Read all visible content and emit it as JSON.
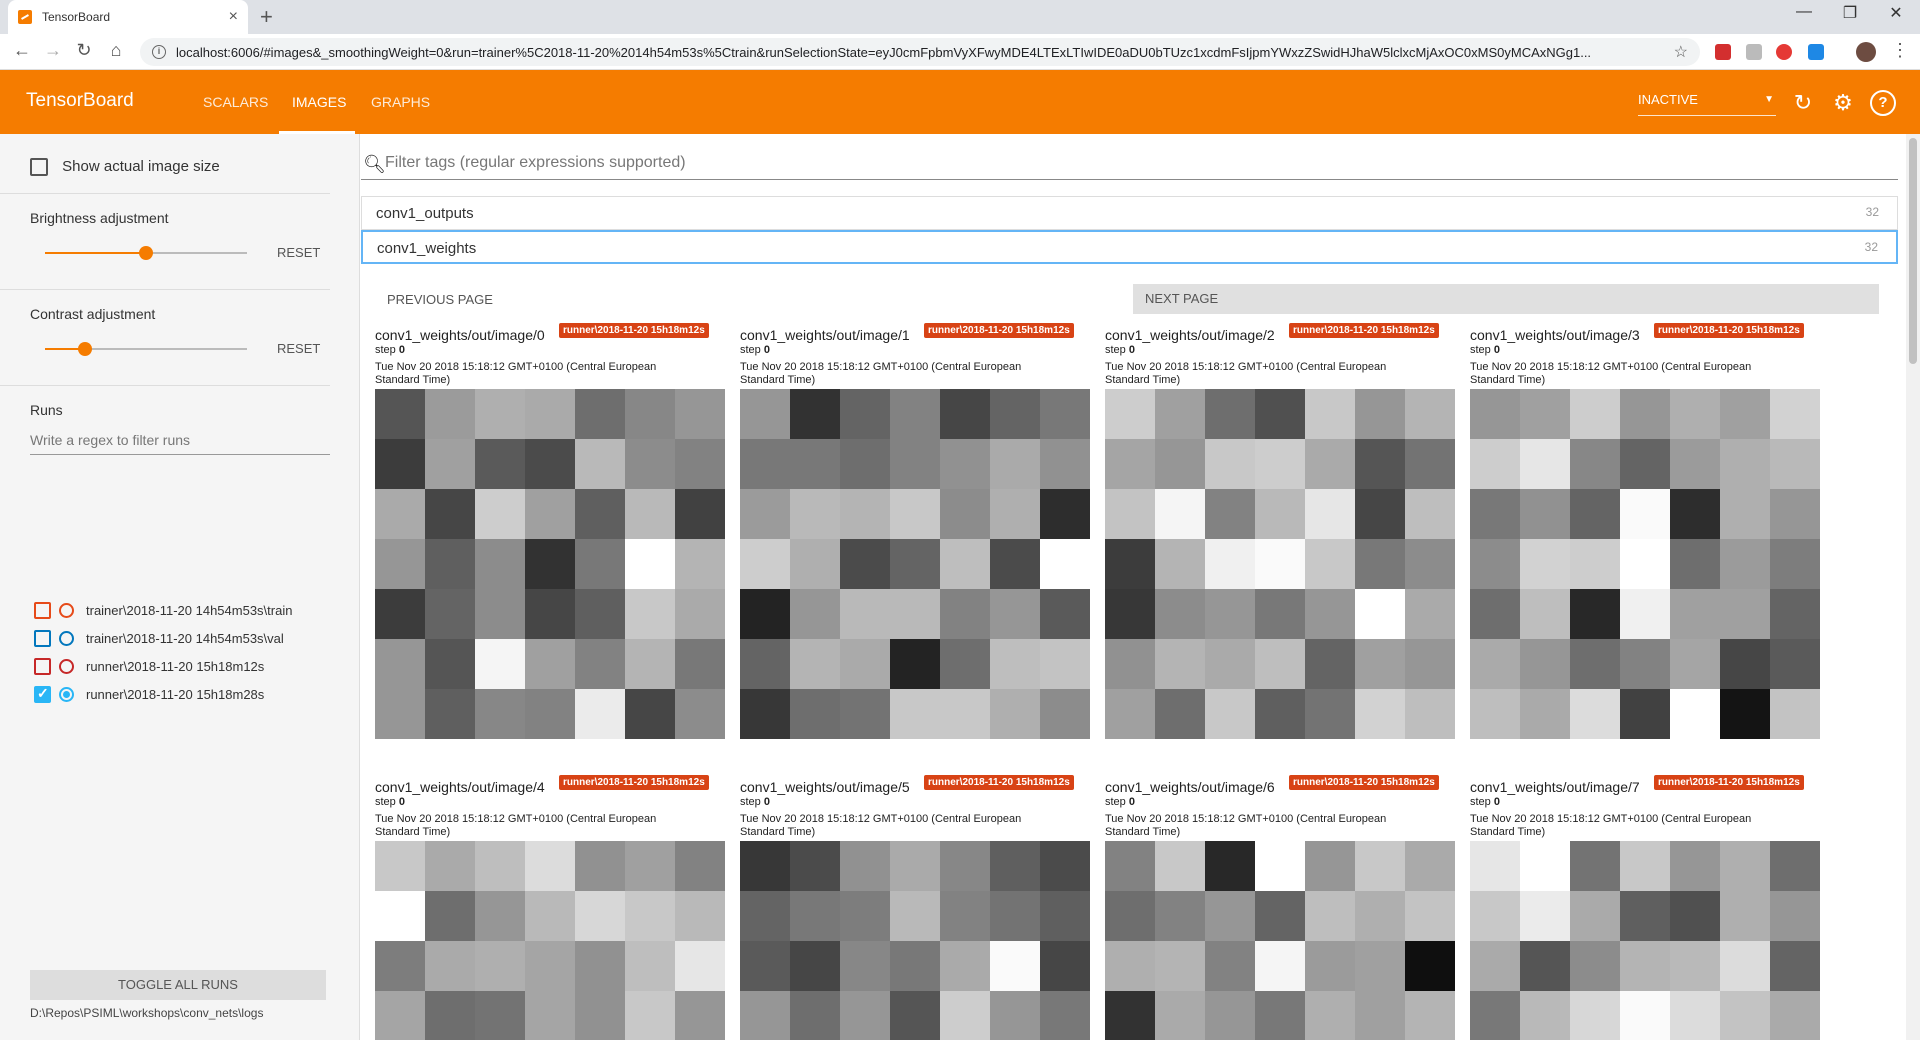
{
  "browser": {
    "tab_title": "TensorBoard",
    "url": "localhost:6006/#images&_smoothingWeight=0&run=trainer%5C2018-11-20%2014h54m53s%5Ctrain&runSelectionState=eyJ0cmFpbmVyXFwyMDE4LTExLTIwIDE0aDU0bTUzc1xcdmFsIjpmYWxzZSwidHJhaW5lclxcMjAxOC0xMS0yMCAxNGg1..."
  },
  "app": {
    "brand": "TensorBoard",
    "tabs": [
      "SCALARS",
      "IMAGES",
      "GRAPHS"
    ],
    "active_tab": "IMAGES",
    "status_select": "INACTIVE",
    "accent_color": "#f57c00"
  },
  "sidebar": {
    "show_actual_size": "Show actual image size",
    "brightness_title": "Brightness adjustment",
    "brightness_level": 0.5,
    "contrast_title": "Contrast adjustment",
    "contrast_level": 0.2,
    "reset_label": "RESET",
    "runs_title": "Runs",
    "runs_filter_placeholder": "Write a regex to filter runs",
    "runs": [
      {
        "name": "trainer\\2018-11-20 14h54m53s\\train",
        "color": "#e64a19",
        "checked": false,
        "selected": false
      },
      {
        "name": "trainer\\2018-11-20 14h54m53s\\val",
        "color": "#0277bd",
        "checked": false,
        "selected": false
      },
      {
        "name": "runner\\2018-11-20 15h18m12s",
        "color": "#c62828",
        "checked": false,
        "selected": false
      },
      {
        "name": "runner\\2018-11-20 15h18m28s",
        "color": "#29b6f6",
        "checked": true,
        "selected": true
      }
    ],
    "toggle_all": "TOGGLE ALL RUNS",
    "logdir": "D:\\Repos\\PSIML\\workshops\\conv_nets\\logs"
  },
  "main": {
    "filter_placeholder": "Filter tags (regular expressions supported)",
    "tags": [
      {
        "name": "conv1_outputs",
        "count": "32"
      },
      {
        "name": "conv1_weights",
        "count": "32"
      }
    ],
    "prev_page": "PREVIOUS PAGE",
    "next_page": "NEXT PAGE",
    "cards": [
      {
        "title": "conv1_weights/out/image/0",
        "badge": "runner\\2018-11-20 15h18m12s",
        "step_label": "step",
        "step": "0",
        "timestamp": "Tue Nov 20 2018 15:18:12 GMT+0100 (Central European Standard Time)",
        "pixels": [
          [
            85,
            155,
            175,
            170,
            110,
            135,
            150
          ],
          [
            60,
            160,
            90,
            75,
            185,
            140,
            130
          ],
          [
            170,
            70,
            205,
            160,
            95,
            185,
            65
          ],
          [
            150,
            95,
            140,
            50,
            120,
            255,
            180
          ],
          [
            60,
            100,
            140,
            70,
            95,
            200,
            170
          ],
          [
            150,
            85,
            245,
            160,
            130,
            180,
            120
          ],
          [
            150,
            95,
            135,
            130,
            235,
            70,
            140
          ]
        ]
      },
      {
        "title": "conv1_weights/out/image/1",
        "badge": "runner\\2018-11-20 15h18m12s",
        "step_label": "step",
        "step": "0",
        "timestamp": "Tue Nov 20 2018 15:18:12 GMT+0100 (Central European Standard Time)",
        "pixels": [
          [
            150,
            50,
            100,
            130,
            70,
            100,
            120
          ],
          [
            120,
            120,
            110,
            130,
            145,
            170,
            145
          ],
          [
            155,
            185,
            180,
            200,
            140,
            175,
            45
          ],
          [
            205,
            175,
            75,
            100,
            190,
            75,
            255
          ],
          [
            35,
            150,
            185,
            185,
            130,
            150,
            90
          ],
          [
            100,
            180,
            170,
            35,
            110,
            190,
            195
          ],
          [
            55,
            110,
            115,
            200,
            200,
            175,
            140
          ]
        ]
      },
      {
        "title": "conv1_weights/out/image/2",
        "badge": "runner\\2018-11-20 15h18m12s",
        "step_label": "step",
        "step": "0",
        "timestamp": "Tue Nov 20 2018 15:18:12 GMT+0100 (Central European Standard Time)",
        "pixels": [
          [
            205,
            160,
            110,
            80,
            200,
            150,
            180
          ],
          [
            165,
            150,
            200,
            205,
            170,
            85,
            115
          ],
          [
            195,
            245,
            130,
            185,
            230,
            70,
            190
          ],
          [
            60,
            180,
            240,
            250,
            200,
            120,
            140
          ],
          [
            55,
            140,
            150,
            120,
            150,
            255,
            170
          ],
          [
            145,
            180,
            170,
            190,
            100,
            160,
            150
          ],
          [
            160,
            110,
            200,
            95,
            115,
            210,
            190
          ]
        ]
      },
      {
        "title": "conv1_weights/out/image/3",
        "badge": "runner\\2018-11-20 15h18m12s",
        "step_label": "step",
        "step": "0",
        "timestamp": "Tue Nov 20 2018 15:18:12 GMT+0100 (Central European Standard Time)",
        "pixels": [
          [
            150,
            160,
            205,
            150,
            175,
            160,
            210
          ],
          [
            205,
            230,
            135,
            100,
            155,
            175,
            185
          ],
          [
            120,
            145,
            100,
            250,
            45,
            175,
            150
          ],
          [
            140,
            210,
            205,
            255,
            110,
            155,
            125
          ],
          [
            110,
            190,
            40,
            240,
            160,
            160,
            100
          ],
          [
            170,
            150,
            110,
            130,
            165,
            70,
            90
          ],
          [
            190,
            170,
            220,
            65,
            255,
            20,
            195
          ]
        ]
      },
      {
        "title": "conv1_weights/out/image/4",
        "badge": "runner\\2018-11-20 15h18m12s",
        "step_label": "step",
        "step": "0",
        "timestamp": "Tue Nov 20 2018 15:18:12 GMT+0100 (Central European Standard Time)",
        "pixels": [
          [
            200,
            170,
            190,
            220,
            145,
            160,
            130
          ],
          [
            255,
            110,
            150,
            185,
            215,
            200,
            185
          ],
          [
            125,
            170,
            175,
            165,
            145,
            190,
            230
          ],
          [
            165,
            110,
            115,
            165,
            145,
            200,
            150
          ]
        ]
      },
      {
        "title": "conv1_weights/out/image/5",
        "badge": "runner\\2018-11-20 15h18m12s",
        "step_label": "step",
        "step": "0",
        "timestamp": "Tue Nov 20 2018 15:18:12 GMT+0100 (Central European Standard Time)",
        "pixels": [
          [
            55,
            75,
            145,
            170,
            135,
            95,
            75
          ],
          [
            100,
            120,
            125,
            185,
            130,
            115,
            95
          ],
          [
            90,
            70,
            135,
            120,
            170,
            250,
            70
          ],
          [
            150,
            110,
            150,
            85,
            205,
            150,
            120
          ]
        ]
      },
      {
        "title": "conv1_weights/out/image/6",
        "badge": "runner\\2018-11-20 15h18m12s",
        "step_label": "step",
        "step": "0",
        "timestamp": "Tue Nov 20 2018 15:18:12 GMT+0100 (Central European Standard Time)",
        "pixels": [
          [
            130,
            200,
            40,
            255,
            150,
            200,
            170
          ],
          [
            110,
            130,
            150,
            100,
            190,
            175,
            195
          ],
          [
            175,
            180,
            130,
            245,
            155,
            160,
            15
          ],
          [
            50,
            170,
            150,
            120,
            175,
            160,
            180
          ]
        ]
      },
      {
        "title": "conv1_weights/out/image/7",
        "badge": "runner\\2018-11-20 15h18m12s",
        "step_label": "step",
        "step": "0",
        "timestamp": "Tue Nov 20 2018 15:18:12 GMT+0100 (Central European Standard Time)",
        "pixels": [
          [
            230,
            255,
            115,
            200,
            150,
            175,
            110
          ],
          [
            200,
            235,
            170,
            95,
            80,
            175,
            150
          ],
          [
            170,
            85,
            140,
            180,
            185,
            220,
            100
          ],
          [
            120,
            185,
            215,
            250,
            220,
            195,
            170
          ]
        ]
      }
    ]
  }
}
